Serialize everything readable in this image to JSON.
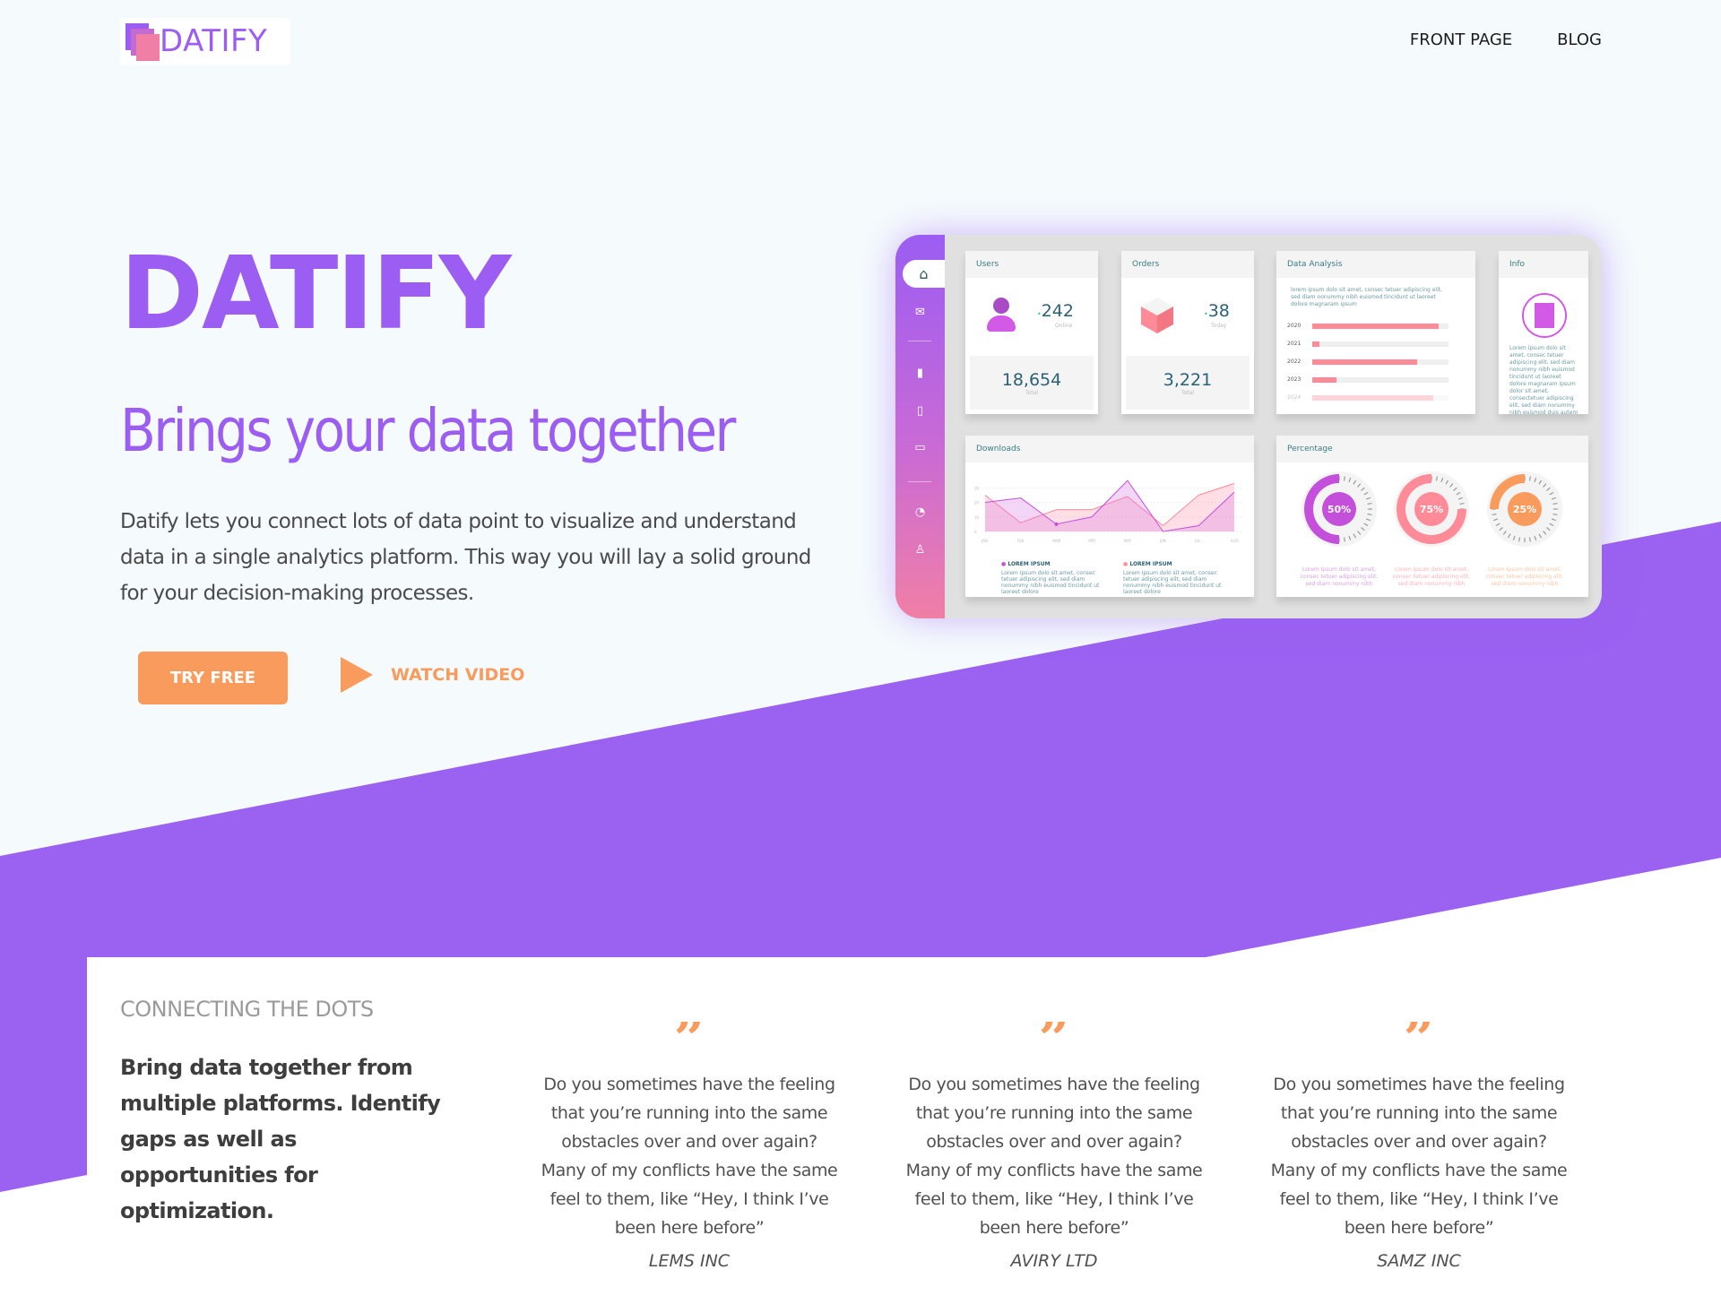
{
  "colors": {
    "brand_purple": "#9b5df2",
    "accent_orange": "#f99b5c",
    "background": "#f5fbfd"
  },
  "header": {
    "logo_text": "DATIFY",
    "nav": [
      {
        "label": "FRONT PAGE"
      },
      {
        "label": "BLOG"
      }
    ]
  },
  "hero": {
    "title": "DATIFY",
    "subtitle": "Brings your data together",
    "description": "Datify lets you connect lots of data point to visualize and understand data in a single analytics platform. This way you will lay a solid ground for your decision-making processes.",
    "cta_primary": "TRY FREE",
    "cta_secondary": "WATCH VIDEO"
  },
  "dashboard": {
    "sidebar_icons": [
      "home-icon",
      "mail-icon",
      "bar-chart-icon",
      "file-icon",
      "monitor-icon",
      "timer-icon",
      "user-icon"
    ],
    "users": {
      "title": "Users",
      "online_value": "242",
      "online_label": "Online",
      "total_value": "18,654",
      "total_label": "Total"
    },
    "orders": {
      "title": "Orders",
      "today_value": "38",
      "today_label": "Today",
      "total_value": "3,221",
      "total_label": "Total"
    },
    "data_analysis": {
      "title": "Data Analysis",
      "intro": "lorem ipsum dolo sit amet, consec tetuer adipiscing elit, sed diam nonummy nibh euismod tincidunt ut laoreet dolore magnaram ipsum",
      "bars": [
        {
          "label": "2020",
          "value": 0.93
        },
        {
          "label": "2021",
          "value": 0.05
        },
        {
          "label": "2022",
          "value": 0.77
        },
        {
          "label": "2023",
          "value": 0.18
        },
        {
          "label": "2024",
          "value": 0.89
        }
      ]
    },
    "info": {
      "title": "Info",
      "text": "Lorem ipsum dolo sit amet, consec tetuer adipiscing elit, sed diam nonummy nibh euismod tincidunt ut laoreet dolore magnaram ipsum dolor sit amet, consectetuer adipiscing elit, sed diam nonummy nibh euismod duis autem"
    },
    "downloads": {
      "title": "Downloads",
      "months": [
        "JAN",
        "FEB",
        "MAR",
        "APR",
        "MAY",
        "JUN",
        "JUL",
        "AUG"
      ],
      "yticks": [
        "0",
        "10",
        "20",
        "30"
      ],
      "series": [
        {
          "name": "LOREM IPSUM",
          "color": "#c34fdb",
          "values": [
            20,
            23,
            5,
            10,
            35,
            0,
            4,
            27
          ]
        },
        {
          "name": "LOREM IPSUM",
          "color": "#ff8a98",
          "values": [
            25,
            6,
            15,
            15,
            24,
            4,
            25,
            33
          ]
        }
      ],
      "legend_text": "Lorem ipsum dolo sit amet, consec tetuer adipiscing elit, sed diam nonummy nibh euismod tincidunt ut laoreet dolore"
    },
    "percentage": {
      "title": "Percentage",
      "gauges": [
        {
          "label": "50%",
          "value": 50,
          "color": "#c34fdb"
        },
        {
          "label": "75%",
          "value": 75,
          "color": "#ff8a98"
        },
        {
          "label": "25%",
          "value": 25,
          "color": "#f99b5c"
        }
      ],
      "caption": "Lorem ipsum dolo sit amet, consec tetuer adipiscing elit, sed diam nonummy nibh"
    }
  },
  "section": {
    "kicker": "CONNECTING THE DOTS",
    "lead": "Bring data together from multiple platforms. Identify gaps as well as opportunities for optimization."
  },
  "testimonials": [
    {
      "quote": "Do you sometimes have the feeling that you’re running into the same obstacles over and over again? Many of my conflicts have the same feel to them, like “Hey, I think I’ve been here before”",
      "author": "LEMS INC"
    },
    {
      "quote": "Do you sometimes have the feeling that you’re running into the same obstacles over and over again? Many of my conflicts have the same feel to them, like “Hey, I think I’ve been here before”",
      "author": "AVIRY LTD"
    },
    {
      "quote": "Do you sometimes have the feeling that you’re running into the same obstacles over and over again? Many of my conflicts have the same feel to them, like “Hey, I think I’ve been here before”",
      "author": "SAMZ INC"
    }
  ]
}
